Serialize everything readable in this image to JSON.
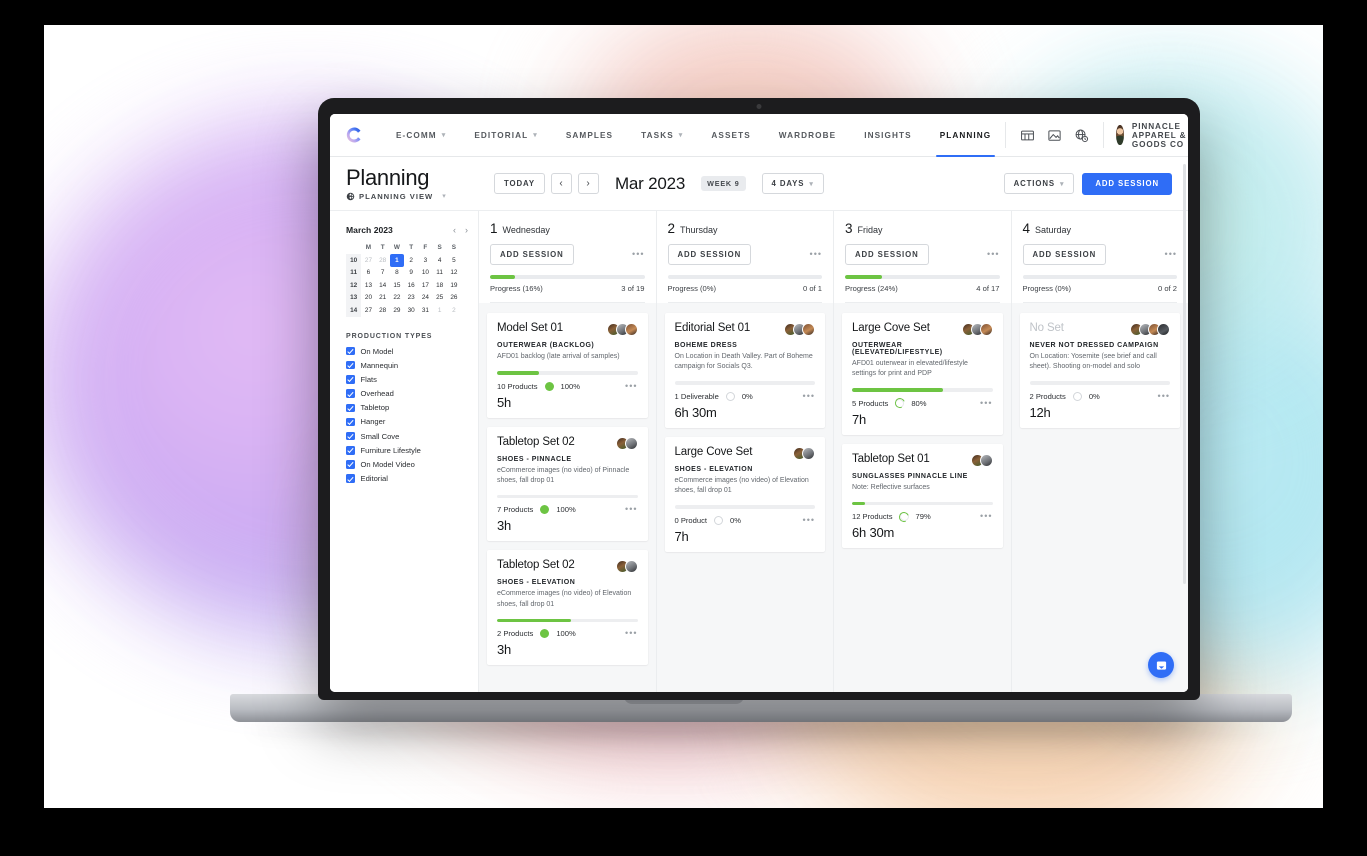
{
  "device": {
    "label": "MacBook Pro"
  },
  "nav": {
    "logo_icon": "c-logo-icon",
    "items": [
      {
        "label": "E-COMM",
        "caret": true,
        "active": false
      },
      {
        "label": "EDITORIAL",
        "caret": true,
        "active": false
      },
      {
        "label": "SAMPLES",
        "caret": false,
        "active": false
      },
      {
        "label": "TASKS",
        "caret": true,
        "active": false
      },
      {
        "label": "ASSETS",
        "caret": false,
        "active": false
      },
      {
        "label": "WARDROBE",
        "caret": false,
        "active": false
      },
      {
        "label": "INSIGHTS",
        "caret": false,
        "active": false
      },
      {
        "label": "PLANNING",
        "caret": false,
        "active": true
      }
    ],
    "tool_icons": [
      "board-view-icon",
      "image-icon",
      "globe-clock-icon"
    ],
    "account": {
      "name": "PINNACLE APPAREL & GOODS CO",
      "avatar": "user-avatar",
      "caret": "▾"
    }
  },
  "header": {
    "title": "Planning",
    "view_icon": "globe-icon",
    "view_label": "PLANNING VIEW",
    "today_label": "TODAY",
    "prev_label": "‹",
    "next_label": "›",
    "date_label": "Mar 2023",
    "week_badge": "WEEK 9",
    "range_label": "4 DAYS",
    "actions_label": "ACTIONS",
    "add_session_label": "ADD SESSION"
  },
  "sidebar": {
    "calendar": {
      "month": "March 2023",
      "prev": "‹",
      "next": "›",
      "weekday_headers": [
        "",
        "M",
        "T",
        "W",
        "T",
        "F",
        "S",
        "S"
      ],
      "weeks": [
        {
          "wk": "10",
          "days": [
            {
              "d": "27",
              "mut": true
            },
            {
              "d": "28",
              "mut": true
            },
            {
              "d": "1",
              "today": true
            },
            {
              "d": "2"
            },
            {
              "d": "3"
            },
            {
              "d": "4"
            },
            {
              "d": "5"
            }
          ]
        },
        {
          "wk": "11",
          "days": [
            {
              "d": "6"
            },
            {
              "d": "7"
            },
            {
              "d": "8"
            },
            {
              "d": "9"
            },
            {
              "d": "10"
            },
            {
              "d": "11"
            },
            {
              "d": "12"
            }
          ]
        },
        {
          "wk": "12",
          "days": [
            {
              "d": "13"
            },
            {
              "d": "14"
            },
            {
              "d": "15"
            },
            {
              "d": "16"
            },
            {
              "d": "17"
            },
            {
              "d": "18"
            },
            {
              "d": "19"
            }
          ]
        },
        {
          "wk": "13",
          "days": [
            {
              "d": "20"
            },
            {
              "d": "21"
            },
            {
              "d": "22"
            },
            {
              "d": "23"
            },
            {
              "d": "24"
            },
            {
              "d": "25"
            },
            {
              "d": "26"
            }
          ]
        },
        {
          "wk": "14",
          "days": [
            {
              "d": "27"
            },
            {
              "d": "28"
            },
            {
              "d": "29"
            },
            {
              "d": "30"
            },
            {
              "d": "31"
            },
            {
              "d": "1",
              "mut": true
            },
            {
              "d": "2",
              "mut": true
            }
          ]
        }
      ]
    },
    "production_types_title": "PRODUCTION TYPES",
    "production_types": [
      {
        "label": "On Model",
        "checked": true
      },
      {
        "label": "Mannequin",
        "checked": true
      },
      {
        "label": "Flats",
        "checked": true
      },
      {
        "label": "Overhead",
        "checked": true
      },
      {
        "label": "Tabletop",
        "checked": true
      },
      {
        "label": "Hanger",
        "checked": true
      },
      {
        "label": "Small Cove",
        "checked": true
      },
      {
        "label": "Furniture Lifestyle",
        "checked": true
      },
      {
        "label": "On Model Video",
        "checked": true
      },
      {
        "label": "Editorial",
        "checked": true
      }
    ]
  },
  "colors": {
    "accent": "#2f6df6",
    "progress_green": "#6dc443",
    "track": "#e9ebee",
    "muted_text": "#bfc3c8"
  },
  "columns": [
    {
      "num": "1",
      "day": "Wednesday",
      "add_session_label": "ADD SESSION",
      "menu": "•••",
      "progress_label": "Progress (16%)",
      "progress_pct": 16,
      "count_label": "3 of 19",
      "cards": [
        {
          "title": "Model Set 01",
          "muted": false,
          "subtitle": "OUTERWEAR (BACKLOG)",
          "desc": "AFD01 backlog (late arrival of samples)",
          "bar_pct": 30,
          "count": "10 Products",
          "status": "full",
          "pct": "100%",
          "duration": "5h",
          "avatars": 3
        },
        {
          "title": "Tabletop Set 02",
          "muted": false,
          "subtitle": "SHOES - PINNACLE",
          "desc": "eCommerce images (no video) of Pinnacle shoes, fall drop 01",
          "bar_pct": 0,
          "count": "7 Products",
          "status": "full",
          "pct": "100%",
          "duration": "3h",
          "avatars": 2
        },
        {
          "title": "Tabletop Set 02",
          "muted": false,
          "subtitle": "SHOES - ELEVATION",
          "desc": "eCommerce images (no video) of Elevation shoes, fall drop 01",
          "bar_pct": 53,
          "count": "2 Products",
          "status": "full",
          "pct": "100%",
          "duration": "3h",
          "avatars": 2
        }
      ]
    },
    {
      "num": "2",
      "day": "Thursday",
      "add_session_label": "ADD SESSION",
      "menu": "•••",
      "progress_label": "Progress (0%)",
      "progress_pct": 0,
      "count_label": "0 of 1",
      "cards": [
        {
          "title": "Editorial Set 01",
          "muted": false,
          "subtitle": "BOHEME DRESS",
          "desc": "On Location in Death Valley. Part of Boheme campaign for Socials Q3.",
          "bar_pct": 0,
          "count": "1 Deliverable",
          "status": "empty",
          "pct": "0%",
          "duration": "6h 30m",
          "avatars": 3
        },
        {
          "title": "Large Cove Set",
          "muted": false,
          "subtitle": "SHOES - ELEVATION",
          "desc": "eCommerce images (no video) of Elevation shoes, fall drop 01",
          "bar_pct": 0,
          "count": "0 Product",
          "status": "empty",
          "pct": "0%",
          "duration": "7h",
          "avatars": 2
        }
      ]
    },
    {
      "num": "3",
      "day": "Friday",
      "add_session_label": "ADD SESSION",
      "menu": "•••",
      "progress_label": "Progress (24%)",
      "progress_pct": 24,
      "count_label": "4 of 17",
      "cards": [
        {
          "title": "Large Cove Set",
          "muted": false,
          "subtitle": "OUTERWEAR (ELEVATED/LIFESTYLE)",
          "desc": "AFD01 outerwear in elevated/lifestyle settings for print and PDP",
          "bar_pct": 65,
          "count": "5 Products",
          "status": "part",
          "pct": "80%",
          "duration": "7h",
          "avatars": 3
        },
        {
          "title": "Tabletop Set 01",
          "muted": false,
          "subtitle": "SUNGLASSES PINNACLE LINE",
          "desc": "Note: Reflective surfaces",
          "bar_pct": 9,
          "count": "12 Products",
          "status": "part",
          "pct": "79%",
          "duration": "6h 30m",
          "avatars": 2
        }
      ]
    },
    {
      "num": "4",
      "day": "Saturday",
      "add_session_label": "ADD SESSION",
      "menu": "•••",
      "progress_label": "Progress (0%)",
      "progress_pct": 0,
      "count_label": "0 of 2",
      "cards": [
        {
          "title": "No Set",
          "muted": true,
          "subtitle": "NEVER NOT DRESSED CAMPAIGN",
          "desc": "On Location: Yosemite (see brief and call sheet). Shooting on-model and solo",
          "bar_pct": 0,
          "count": "2 Products",
          "status": "empty",
          "pct": "0%",
          "duration": "12h",
          "avatars": 4
        }
      ]
    }
  ],
  "chat": {
    "icon": "chat-bubble-icon"
  }
}
